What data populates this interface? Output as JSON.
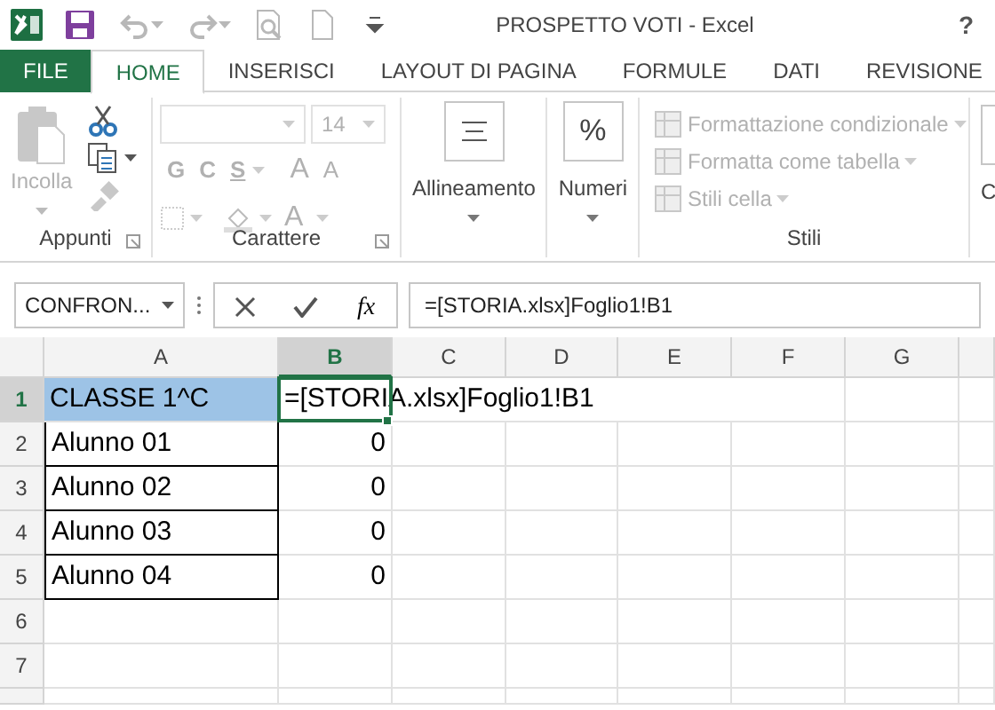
{
  "window": {
    "title": "PROSPETTO VOTI - Excel",
    "help": "?"
  },
  "quick_access": [
    {
      "kind": "save"
    },
    {
      "kind": "undo",
      "disabled": true
    },
    {
      "kind": "redo",
      "disabled": true
    },
    {
      "kind": "preview",
      "disabled": true
    },
    {
      "kind": "page",
      "disabled": true
    },
    {
      "kind": "customize"
    }
  ],
  "tabs": [
    {
      "label": "FILE",
      "kind": "file",
      "selected": false
    },
    {
      "label": "HOME",
      "kind": "tab",
      "selected": true
    },
    {
      "label": "INSERISCI",
      "kind": "tab",
      "selected": false
    },
    {
      "label": "LAYOUT DI PAGINA",
      "kind": "tab",
      "selected": false
    },
    {
      "label": "FORMULE",
      "kind": "tab",
      "selected": false
    },
    {
      "label": "DATI",
      "kind": "tab",
      "selected": false
    },
    {
      "label": "REVISIONE",
      "kind": "tab",
      "selected": false
    }
  ],
  "ribbon": [
    {
      "kind": "clipboard",
      "label": "Appunti",
      "paste": {
        "label": "Incolla",
        "disabled": true
      },
      "tools": [
        {
          "kind": "cut",
          "disabled": false
        },
        {
          "kind": "copy",
          "disabled": false
        },
        {
          "kind": "painter",
          "disabled": true
        }
      ]
    },
    {
      "kind": "font",
      "label": "Carattere",
      "font_size": "14",
      "disabled": true,
      "styles": [
        "G",
        "C",
        "S"
      ],
      "grow": "A",
      "shrink": "A",
      "font_color": "A"
    },
    {
      "kind": "align",
      "button": "Allineamento"
    },
    {
      "kind": "number",
      "button": "Numeri",
      "glyph": "%"
    },
    {
      "kind": "styles",
      "label": "Stili",
      "items": [
        {
          "label": "Formattazione condizionale",
          "disabled": true
        },
        {
          "label": "Formatta come tabella",
          "disabled": true
        },
        {
          "label": "Stili cella",
          "disabled": true
        }
      ]
    },
    {
      "kind": "cut_off",
      "button": "C"
    }
  ],
  "formula_bar": {
    "name_box": "CONFRON...",
    "fx": "fx",
    "formula": "=[STORIA.xlsx]Foglio1!B1"
  },
  "sheet": {
    "columns": [
      {
        "label": "A",
        "selected": false
      },
      {
        "label": "B",
        "selected": true
      },
      {
        "label": "C",
        "selected": false
      },
      {
        "label": "D",
        "selected": false
      },
      {
        "label": "E",
        "selected": false
      },
      {
        "label": "F",
        "selected": false
      },
      {
        "label": "G",
        "selected": false
      }
    ],
    "rows": [
      {
        "label": "1",
        "selected": true,
        "cells": [
          {
            "text": "CLASSE 1^C",
            "kind": "text",
            "highlighted": true,
            "bordered": false
          },
          {
            "text": "=[STORIA.xlsx]Foglio1!B1",
            "kind": "editing"
          }
        ]
      },
      {
        "label": "2",
        "selected": false,
        "cells": [
          {
            "text": "Alunno 01",
            "kind": "text",
            "highlighted": false,
            "bordered": true
          },
          {
            "text": "0",
            "kind": "number"
          }
        ]
      },
      {
        "label": "3",
        "selected": false,
        "cells": [
          {
            "text": "Alunno 02",
            "kind": "text",
            "highlighted": false,
            "bordered": true
          },
          {
            "text": "0",
            "kind": "number"
          }
        ]
      },
      {
        "label": "4",
        "selected": false,
        "cells": [
          {
            "text": "Alunno 03",
            "kind": "text",
            "highlighted": false,
            "bordered": true
          },
          {
            "text": "0",
            "kind": "number"
          }
        ]
      },
      {
        "label": "5",
        "selected": false,
        "cells": [
          {
            "text": "Alunno 04",
            "kind": "text",
            "highlighted": false,
            "bordered": true
          },
          {
            "text": "0",
            "kind": "number"
          }
        ]
      },
      {
        "label": "6",
        "selected": false,
        "cells": []
      },
      {
        "label": "7",
        "selected": false,
        "cells": []
      }
    ]
  }
}
